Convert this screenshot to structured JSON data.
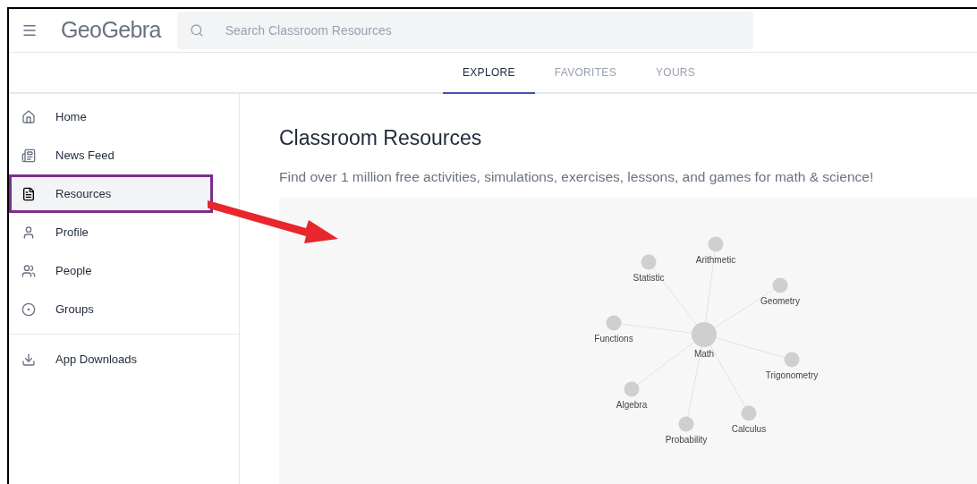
{
  "header": {
    "logo": "GeoGebra",
    "search": {
      "placeholder": "Search Classroom Resources"
    }
  },
  "tabs": [
    {
      "label": "EXPLORE",
      "selected": true
    },
    {
      "label": "FAVORITES",
      "selected": false
    },
    {
      "label": "YOURS",
      "selected": false
    }
  ],
  "sidebar": {
    "items": [
      {
        "label": "Home",
        "kind": "home",
        "selected": false,
        "highlighted": false
      },
      {
        "label": "News Feed",
        "kind": "feed",
        "selected": false,
        "highlighted": false
      },
      {
        "label": "Resources",
        "kind": "doc",
        "selected": true,
        "highlighted": true
      },
      {
        "label": "Profile",
        "kind": "person",
        "selected": false,
        "highlighted": false
      },
      {
        "label": "People",
        "kind": "people",
        "selected": false,
        "highlighted": false
      },
      {
        "label": "Groups",
        "kind": "groups",
        "selected": false,
        "highlighted": false
      },
      {
        "label": "App Downloads",
        "kind": "download",
        "selected": false,
        "highlighted": false,
        "divider_before": true
      }
    ]
  },
  "main": {
    "title": "Classroom Resources",
    "subtitle": "Find over 1 million free activities, simulations, exercises, lessons, and games for math & science!",
    "graph": {
      "center": "Math",
      "topics": [
        "Arithmetic",
        "Statistic",
        "Geometry",
        "Functions",
        "Trigonometry",
        "Algebra",
        "Probability",
        "Calculus"
      ]
    }
  }
}
